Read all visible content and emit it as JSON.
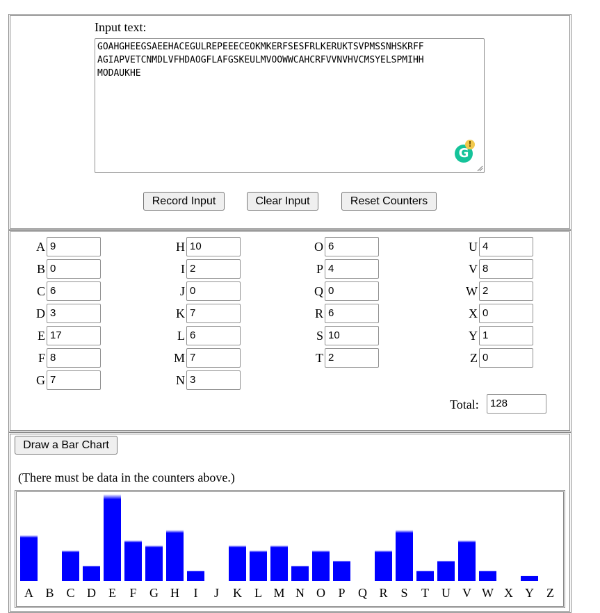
{
  "input": {
    "label": "Input text:",
    "text": "GOAHGHEEGSAEEHACEGULREPEEECEOKMKERFSESFRLKERUKTSVPMSSNHSKRFF\nAGIAPVETCNMDLVFHDAOGFLAFGSKEULMVOOWWCAHCRFVVNVHVCMSYELSPMIHH\nMODAUKHE"
  },
  "buttons": {
    "record": "Record Input",
    "clear": "Clear Input",
    "reset": "Reset Counters",
    "draw": "Draw a Bar Chart"
  },
  "counters": [
    {
      "letter": "A",
      "value": "9"
    },
    {
      "letter": "B",
      "value": "0"
    },
    {
      "letter": "C",
      "value": "6"
    },
    {
      "letter": "D",
      "value": "3"
    },
    {
      "letter": "E",
      "value": "17"
    },
    {
      "letter": "F",
      "value": "8"
    },
    {
      "letter": "G",
      "value": "7"
    },
    {
      "letter": "H",
      "value": "10"
    },
    {
      "letter": "I",
      "value": "2"
    },
    {
      "letter": "J",
      "value": "0"
    },
    {
      "letter": "K",
      "value": "7"
    },
    {
      "letter": "L",
      "value": "6"
    },
    {
      "letter": "M",
      "value": "7"
    },
    {
      "letter": "N",
      "value": "3"
    },
    {
      "letter": "O",
      "value": "6"
    },
    {
      "letter": "P",
      "value": "4"
    },
    {
      "letter": "Q",
      "value": "0"
    },
    {
      "letter": "R",
      "value": "6"
    },
    {
      "letter": "S",
      "value": "10"
    },
    {
      "letter": "T",
      "value": "2"
    },
    {
      "letter": "U",
      "value": "4"
    },
    {
      "letter": "V",
      "value": "8"
    },
    {
      "letter": "W",
      "value": "2"
    },
    {
      "letter": "X",
      "value": "0"
    },
    {
      "letter": "Y",
      "value": "1"
    },
    {
      "letter": "Z",
      "value": "0"
    }
  ],
  "total": {
    "label": "Total:",
    "value": "128"
  },
  "chart_note": "(There must be data in the counters above.)",
  "chart_data": {
    "type": "bar",
    "categories": [
      "A",
      "B",
      "C",
      "D",
      "E",
      "F",
      "G",
      "H",
      "I",
      "J",
      "K",
      "L",
      "M",
      "N",
      "O",
      "P",
      "Q",
      "R",
      "S",
      "T",
      "U",
      "V",
      "W",
      "X",
      "Y",
      "Z"
    ],
    "values": [
      9,
      0,
      6,
      3,
      17,
      8,
      7,
      10,
      2,
      0,
      7,
      6,
      7,
      3,
      6,
      4,
      0,
      6,
      10,
      2,
      4,
      8,
      2,
      0,
      1,
      0
    ],
    "bar_color": "#0000ff"
  },
  "colors": {
    "bar": "#0000ff",
    "grammarly": "#15c39a",
    "alert": "#f2c94c"
  }
}
